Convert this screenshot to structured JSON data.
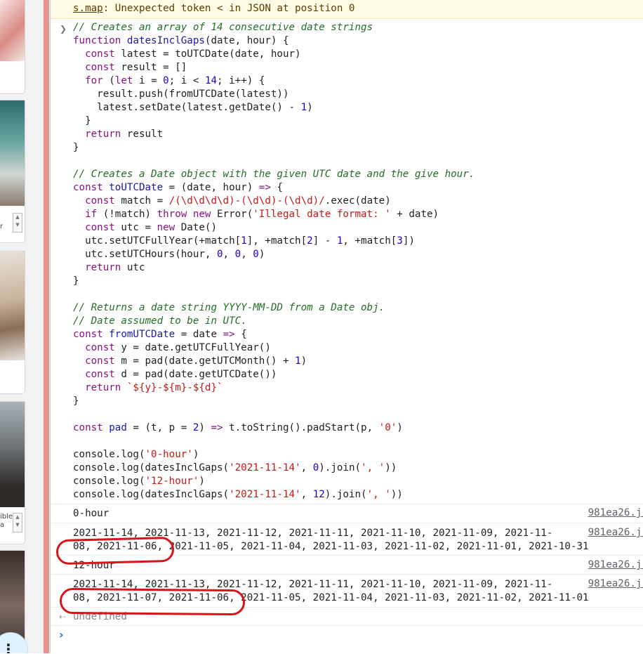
{
  "warning": {
    "source_file": "s.map",
    "message": ": Unexpected token < in JSON at position 0"
  },
  "code_lines": [
    [
      [
        "cm",
        "// Creates an array of 14 consecutive date strings"
      ]
    ],
    [
      [
        "kw",
        "function "
      ],
      [
        "fn",
        "datesInclGaps"
      ],
      [
        "ty",
        "("
      ],
      [
        "vr",
        "date, hour"
      ],
      [
        "ty",
        ") {"
      ]
    ],
    [
      [
        "ty",
        "  "
      ],
      [
        "kw",
        "const "
      ],
      [
        "vr",
        "latest = toUTCDate(date, hour)"
      ]
    ],
    [
      [
        "ty",
        "  "
      ],
      [
        "kw",
        "const "
      ],
      [
        "vr",
        "result = []"
      ]
    ],
    [
      [
        "ty",
        "  "
      ],
      [
        "kw",
        "for "
      ],
      [
        "ty",
        "("
      ],
      [
        "kw",
        "let "
      ],
      [
        "vr",
        "i = "
      ],
      [
        "num",
        "0"
      ],
      [
        "vr",
        "; i < "
      ],
      [
        "num",
        "14"
      ],
      [
        "vr",
        "; i++) {"
      ]
    ],
    [
      [
        "ty",
        "    result.push(fromUTCDate(latest))"
      ]
    ],
    [
      [
        "ty",
        "    latest.setDate(latest.getDate() - "
      ],
      [
        "num",
        "1"
      ],
      [
        "ty",
        ")"
      ]
    ],
    [
      [
        "ty",
        "  }"
      ]
    ],
    [
      [
        "ty",
        "  "
      ],
      [
        "kw",
        "return "
      ],
      [
        "vr",
        "result"
      ]
    ],
    [
      [
        "ty",
        "}"
      ]
    ],
    [
      [
        "ty",
        ""
      ]
    ],
    [
      [
        "cm",
        "// Creates a Date object with the given UTC date and the give hour."
      ]
    ],
    [
      [
        "kw",
        "const "
      ],
      [
        "fn",
        "toUTCDate"
      ],
      [
        "ty",
        " = (date, hour) "
      ],
      [
        "kw",
        "=> "
      ],
      [
        "ty",
        "{"
      ]
    ],
    [
      [
        "ty",
        "  "
      ],
      [
        "kw",
        "const "
      ],
      [
        "vr",
        "match = "
      ],
      [
        "str",
        "/(\\d\\d\\d\\d)-(\\d\\d)-(\\d\\d)/"
      ],
      [
        "ty",
        ".exec(date)"
      ]
    ],
    [
      [
        "ty",
        "  "
      ],
      [
        "kw",
        "if "
      ],
      [
        "ty",
        "(!match) "
      ],
      [
        "kw",
        "throw new "
      ],
      [
        "ty",
        "Error("
      ],
      [
        "str",
        "'Illegal date format: '"
      ],
      [
        "ty",
        " + date)"
      ]
    ],
    [
      [
        "ty",
        "  "
      ],
      [
        "kw",
        "const "
      ],
      [
        "vr",
        "utc = "
      ],
      [
        "kw",
        "new "
      ],
      [
        "ty",
        "Date()"
      ]
    ],
    [
      [
        "ty",
        "  utc.setUTCFullYear(+match["
      ],
      [
        "num",
        "1"
      ],
      [
        "ty",
        "], +match["
      ],
      [
        "num",
        "2"
      ],
      [
        "ty",
        "] - "
      ],
      [
        "num",
        "1"
      ],
      [
        "ty",
        ", +match["
      ],
      [
        "num",
        "3"
      ],
      [
        "ty",
        "])"
      ]
    ],
    [
      [
        "ty",
        "  utc.setUTCHours(hour, "
      ],
      [
        "num",
        "0"
      ],
      [
        "ty",
        ", "
      ],
      [
        "num",
        "0"
      ],
      [
        "ty",
        ", "
      ],
      [
        "num",
        "0"
      ],
      [
        "ty",
        ")"
      ]
    ],
    [
      [
        "ty",
        "  "
      ],
      [
        "kw",
        "return "
      ],
      [
        "vr",
        "utc"
      ]
    ],
    [
      [
        "ty",
        "}"
      ]
    ],
    [
      [
        "ty",
        ""
      ]
    ],
    [
      [
        "cm",
        "// Returns a date string YYYY-MM-DD from a Date obj."
      ]
    ],
    [
      [
        "cm",
        "// Date assumed to be in UTC."
      ]
    ],
    [
      [
        "kw",
        "const "
      ],
      [
        "fn",
        "fromUTCDate"
      ],
      [
        "ty",
        " = date "
      ],
      [
        "kw",
        "=> "
      ],
      [
        "ty",
        "{"
      ]
    ],
    [
      [
        "ty",
        "  "
      ],
      [
        "kw",
        "const "
      ],
      [
        "vr",
        "y = date.getUTCFullYear()"
      ]
    ],
    [
      [
        "ty",
        "  "
      ],
      [
        "kw",
        "const "
      ],
      [
        "vr",
        "m = pad(date.getUTCMonth() + "
      ],
      [
        "num",
        "1"
      ],
      [
        "ty",
        ")"
      ]
    ],
    [
      [
        "ty",
        "  "
      ],
      [
        "kw",
        "const "
      ],
      [
        "vr",
        "d = pad(date.getUTCDate())"
      ]
    ],
    [
      [
        "ty",
        "  "
      ],
      [
        "kw",
        "return "
      ],
      [
        "str",
        "`${y}-${m}-${d}`"
      ]
    ],
    [
      [
        "ty",
        "}"
      ]
    ],
    [
      [
        "ty",
        ""
      ]
    ],
    [
      [
        "kw",
        "const "
      ],
      [
        "fn",
        "pad"
      ],
      [
        "ty",
        " = (t, p = "
      ],
      [
        "num",
        "2"
      ],
      [
        "ty",
        ") "
      ],
      [
        "kw",
        "=> "
      ],
      [
        "ty",
        "t.toString().padStart(p, "
      ],
      [
        "str",
        "'0'"
      ],
      [
        "ty",
        ")"
      ]
    ],
    [
      [
        "ty",
        ""
      ]
    ],
    [
      [
        "ty",
        "console.log("
      ],
      [
        "str",
        "'0-hour'"
      ],
      [
        "ty",
        ")"
      ]
    ],
    [
      [
        "ty",
        "console.log(datesInclGaps("
      ],
      [
        "str",
        "'2021-11-14'"
      ],
      [
        "ty",
        ", "
      ],
      [
        "num",
        "0"
      ],
      [
        "ty",
        ").join("
      ],
      [
        "str",
        "', '"
      ],
      [
        "ty",
        "))"
      ]
    ],
    [
      [
        "ty",
        "console.log("
      ],
      [
        "str",
        "'12-hour'"
      ],
      [
        "ty",
        ")"
      ]
    ],
    [
      [
        "ty",
        "console.log(datesInclGaps("
      ],
      [
        "str",
        "'2021-11-14'"
      ],
      [
        "ty",
        ", "
      ],
      [
        "num",
        "12"
      ],
      [
        "ty",
        ").join("
      ],
      [
        "str",
        "', '"
      ],
      [
        "ty",
        "))"
      ]
    ]
  ],
  "outputs": [
    {
      "lines": [
        "0-hour"
      ],
      "source": "981ea26.js"
    },
    {
      "lines": [
        "2021-11-14, 2021-11-13, 2021-11-12, 2021-11-11, 2021-11-10, 2021-11-09, 2021-11-",
        "08, 2021-11-06, 2021-11-05, 2021-11-04, 2021-11-03, 2021-11-02, 2021-11-01, 2021-10-31"
      ],
      "source": "981ea26.js"
    },
    {
      "lines": [
        "12-hour"
      ],
      "source": "981ea26.js"
    },
    {
      "lines": [
        "2021-11-14, 2021-11-13, 2021-11-12, 2021-11-11, 2021-11-10, 2021-11-09, 2021-11-",
        "08, 2021-11-07, 2021-11-06, 2021-11-05, 2021-11-04, 2021-11-03, 2021-11-02, 2021-11-01"
      ],
      "source": "981ea26.js"
    }
  ],
  "return_value": "undefined",
  "left_strip": {
    "labels": [
      "r",
      "ible",
      "a"
    ]
  },
  "colors": {
    "comment": "#236e25",
    "keyword": "#881280",
    "string": "#c41a16",
    "number": "#1c00cf",
    "annotation": "#d7141a"
  },
  "icons": {
    "expand": "chevron-right-icon",
    "result": "return-arrow-icon",
    "prompt": "prompt-chevron-icon",
    "fab": "more-dots-icon"
  }
}
